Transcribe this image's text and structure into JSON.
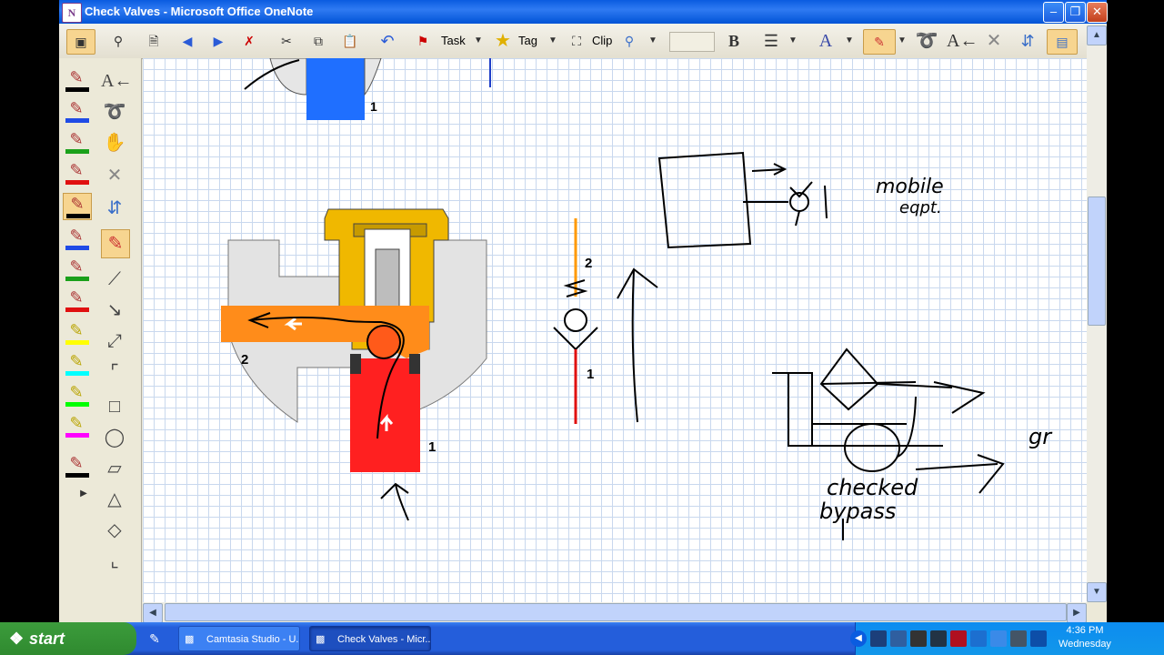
{
  "window": {
    "title": "Check Valves - Microsoft Office OneNote",
    "app_icon_letter": "N"
  },
  "toolbar": {
    "task_label": "Task",
    "tag_label": "Tag",
    "clip_label": "Clip"
  },
  "canvas": {
    "labels": {
      "port_top_1": "1",
      "port_left_2": "2",
      "port_bottom_1": "1",
      "symbol_port_2": "2",
      "symbol_port_1": "1"
    },
    "handwriting": {
      "mobile_equipment": [
        "mobile",
        "eqpt."
      ],
      "checked_bypass": [
        "checked",
        "bypass"
      ],
      "fragment": "gr"
    }
  },
  "taskbar": {
    "start_label": "start",
    "items": [
      {
        "label": "Camtasia Studio - U..."
      },
      {
        "label": "Check Valves - Micr..."
      }
    ],
    "clock": {
      "time": "4:36 PM",
      "day": "Wednesday"
    }
  },
  "colors": {
    "accent_blue": "#1f6fff",
    "fitting_orange": "#ff8c1a",
    "fluid_red": "#ff2020",
    "grid": "#c9d8ee"
  }
}
